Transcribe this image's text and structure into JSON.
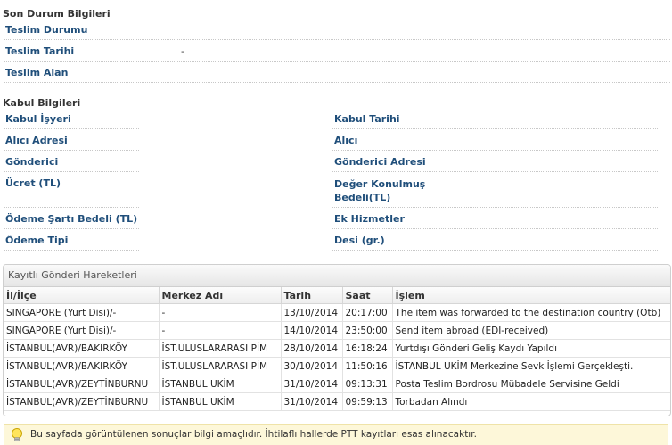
{
  "son_durum": {
    "title": "Son Durum Bilgileri",
    "fields": [
      {
        "label": "Teslim Durumu",
        "value": ""
      },
      {
        "label": "Teslim Tarihi",
        "value": "-"
      },
      {
        "label": "Teslim Alan",
        "value": ""
      }
    ]
  },
  "kabul": {
    "title": "Kabul Bilgileri",
    "left": [
      "Kabul İşyeri",
      "Alıcı Adresi",
      "Gönderici",
      "Ücret (TL)",
      "Ödeme Şartı Bedeli (TL)",
      "Ödeme Tipi"
    ],
    "right": [
      "Kabul Tarihi",
      "Alıcı",
      "Gönderici Adresi",
      "Değer Konulmuş Bedeli(TL)",
      "Ek Hizmetler",
      "Desi (gr.)"
    ]
  },
  "hareketler": {
    "title": "Kayıtlı Gönderi Hareketleri",
    "columns": [
      "İl/İlçe",
      "Merkez Adı",
      "Tarih",
      "Saat",
      "İşlem"
    ],
    "rows": [
      [
        "SINGAPORE (Yurt Disi)/-",
        "-",
        "13/10/2014",
        "20:17:00",
        "The item was forwarded to the destination country (Otb)"
      ],
      [
        "SINGAPORE (Yurt Disi)/-",
        "-",
        "14/10/2014",
        "23:50:00",
        "Send item abroad (EDI-received)"
      ],
      [
        "İSTANBUL(AVR)/BAKIRKÖY",
        "İST.ULUSLARARASI PİM",
        "28/10/2014",
        "16:18:24",
        "Yurtdışı Gönderi Geliş Kaydı Yapıldı"
      ],
      [
        "İSTANBUL(AVR)/BAKIRKÖY",
        "İST.ULUSLARARASI PİM",
        "30/10/2014",
        "11:50:16",
        "İSTANBUL UKİM Merkezine Sevk İşlemi Gerçekleşti."
      ],
      [
        "İSTANBUL(AVR)/ZEYTİNBURNU",
        "İSTANBUL UKİM",
        "31/10/2014",
        "09:13:31",
        "Posta Teslim Bordrosu Mübadele Servisine Geldi"
      ],
      [
        "İSTANBUL(AVR)/ZEYTİNBURNU",
        "İSTANBUL UKİM",
        "31/10/2014",
        "09:59:13",
        "Torbadan Alındı"
      ]
    ]
  },
  "note": {
    "icon": "lightbulb-icon",
    "text": "Bu sayfada görüntülenen sonuçlar bilgi amaçlıdır. İhtilaflı hallerde PTT kayıtları esas alınacaktır."
  },
  "colors": {
    "label": "#1f4e7a",
    "note_bg": "#fdf7d9"
  }
}
